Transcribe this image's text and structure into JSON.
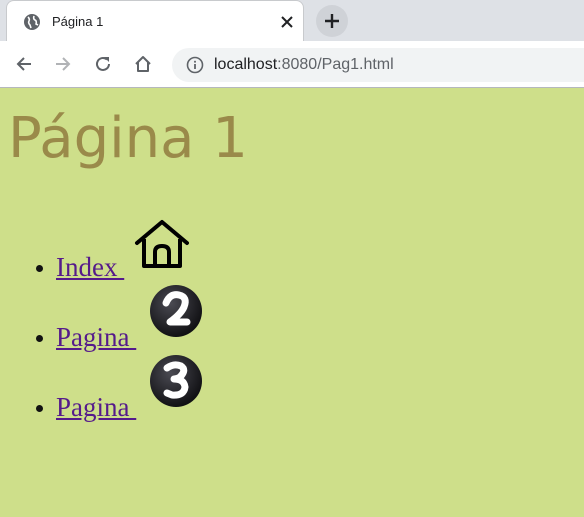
{
  "browser": {
    "tab_title": "Página 1",
    "url_host": "localhost",
    "url_path": ":8080/Pag1.html",
    "new_tab_symbol": "+",
    "close_symbol": "✕"
  },
  "page": {
    "background": "#cedf8a",
    "heading": "Página 1",
    "heading_color": "#9a8a4a",
    "link_color": "#551a8b",
    "links": [
      {
        "label": "Index ",
        "icon": "home-icon"
      },
      {
        "label": "Pagina ",
        "icon": "number-2-badge-icon"
      },
      {
        "label": "Pagina ",
        "icon": "number-3-badge-icon"
      }
    ]
  }
}
